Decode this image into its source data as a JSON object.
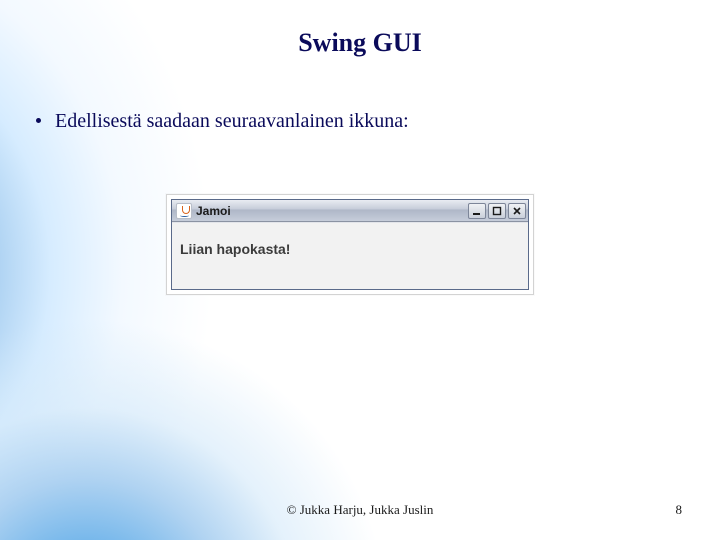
{
  "slide": {
    "title": "Swing GUI",
    "bullet": "Edellisestä saadaan seuraavanlainen ikkuna:",
    "credit": "© Jukka Harju, Jukka Juslin",
    "page_number": "8"
  },
  "swing": {
    "window_title": "Jamoi",
    "label": "Liian hapokasta!"
  }
}
